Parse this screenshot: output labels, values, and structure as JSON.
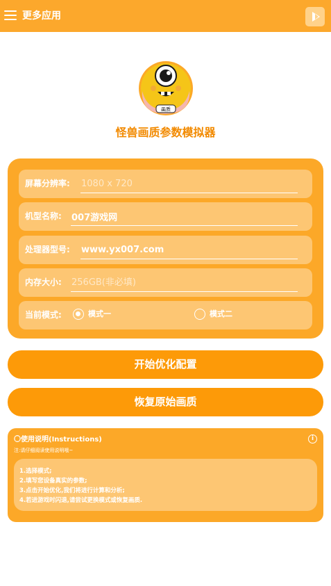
{
  "topbar": {
    "title": "更多应用",
    "menu_icon": "hamburger-menu-icon",
    "play_icon": "play-icon"
  },
  "app": {
    "title": "怪兽画质参数模拟器",
    "logo_icon": "monster-logo-icon",
    "logo_badge": "画质"
  },
  "form": {
    "resolution": {
      "label": "屏幕分辨率:",
      "value": "",
      "placeholder": "1080 x 720"
    },
    "model": {
      "label": "机型名称:",
      "value": "007游戏网",
      "placeholder": ""
    },
    "processor": {
      "label": "处理器型号:",
      "value": "www.yx007.com",
      "placeholder": ""
    },
    "memory": {
      "label": "内存大小:",
      "value": "",
      "placeholder": "256GB(非必填)"
    },
    "mode": {
      "label": "当前模式:",
      "options": [
        "模式一",
        "模式二"
      ],
      "selected": "模式一"
    }
  },
  "buttons": {
    "start": "开始优化配置",
    "restore": "恢复原始画质"
  },
  "instructions": {
    "title": "〇使用说明(Instructions)",
    "note": "注:请仔细阅读使用说明哦~",
    "steps": [
      "1.选择模式;",
      "2.填写您设备真实的参数;",
      "3.点击开始优化,我们将进行计算和分析;",
      "4.若进游戏时闪退,请尝试更换模式或恢复画质."
    ],
    "info_icon": "info-icon"
  },
  "colors": {
    "accent": "#FCA82C",
    "button": "#FD9A08",
    "title": "#F28A00",
    "logo_fill": "#F5C518"
  }
}
